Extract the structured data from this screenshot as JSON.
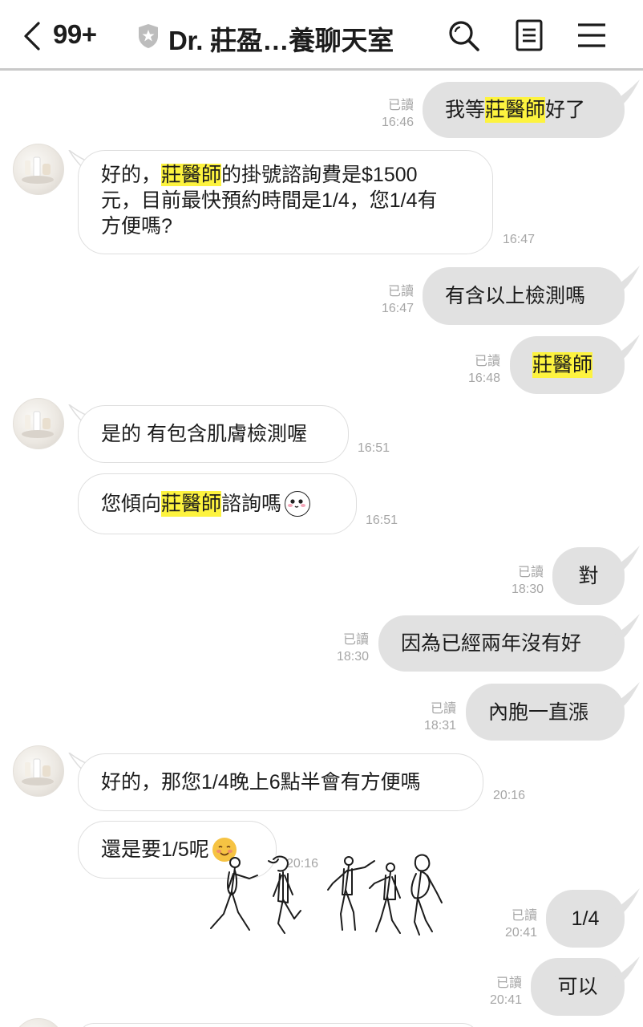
{
  "header": {
    "unread_count": "99+",
    "title": "Dr. 莊盈…養聊天室"
  },
  "read_label": "已讀",
  "highlight_term": "莊醫師",
  "messages": [
    {
      "id": "m1",
      "side": "me",
      "parts": [
        {
          "t": "我等"
        },
        {
          "t": "莊醫師",
          "hl": true
        },
        {
          "t": "好了"
        }
      ],
      "read": "已讀",
      "time": "16:46"
    },
    {
      "id": "m2",
      "side": "them",
      "lines": [
        [
          {
            "t": "好的，"
          },
          {
            "t": "莊醫師",
            "hl": true
          },
          {
            "t": "的掛號諮詢費是$1500"
          }
        ],
        [
          {
            "t": "元，目前最快預約時間是1/4，您1/4有"
          }
        ],
        [
          {
            "t": "方便嗎?"
          }
        ]
      ],
      "time": "16:47"
    },
    {
      "id": "m3",
      "side": "me",
      "parts": [
        {
          "t": "有含以上檢測嗎"
        }
      ],
      "read": "已讀",
      "time": "16:47"
    },
    {
      "id": "m4",
      "side": "me",
      "parts": [
        {
          "t": "莊醫師",
          "hl": true
        }
      ],
      "read": "已讀",
      "time": "16:48"
    },
    {
      "id": "m5",
      "side": "them",
      "parts": [
        {
          "t": "是的 有包含肌膚檢測喔"
        }
      ],
      "time": "16:51"
    },
    {
      "id": "m6",
      "side": "them",
      "parts": [
        {
          "t": "您傾向"
        },
        {
          "t": "莊醫師",
          "hl": true
        },
        {
          "t": "諮詢嗎"
        }
      ],
      "emoji": "blushing-face-emoji",
      "time": "16:51"
    },
    {
      "id": "m7",
      "side": "me",
      "parts": [
        {
          "t": "對"
        }
      ],
      "read": "已讀",
      "time": "18:30"
    },
    {
      "id": "m8",
      "side": "me",
      "parts": [
        {
          "t": "因為已經兩年沒有好"
        }
      ],
      "read": "已讀",
      "time": "18:30"
    },
    {
      "id": "m9",
      "side": "me",
      "parts": [
        {
          "t": "內胞一直漲"
        }
      ],
      "read": "已讀",
      "time": "18:31"
    },
    {
      "id": "m10",
      "side": "them",
      "parts": [
        {
          "t": "好的，那您1/4晚上6點半會有方便嗎"
        }
      ],
      "time": "20:16"
    },
    {
      "id": "m11",
      "side": "them",
      "parts": [
        {
          "t": "還是要1/5呢"
        }
      ],
      "emoji": "smiling-face-emoji",
      "time": "20:16"
    },
    {
      "id": "m12",
      "side": "me",
      "parts": [
        {
          "t": "1/4"
        }
      ],
      "read": "已讀",
      "time": "20:41"
    },
    {
      "id": "m13",
      "side": "me",
      "parts": [
        {
          "t": "可以"
        }
      ],
      "read": "已讀",
      "time": "20:41"
    }
  ],
  "icons": {
    "back": "chevron-left-icon",
    "verified": "shield-star-icon",
    "search": "search-icon",
    "notes": "notes-icon",
    "menu": "menu-icon"
  },
  "colors": {
    "my_bubble": "#e1e1e1",
    "their_bubble": "#ffffff",
    "highlight": "#fdf33f",
    "meta_text": "#a6a6a6"
  }
}
